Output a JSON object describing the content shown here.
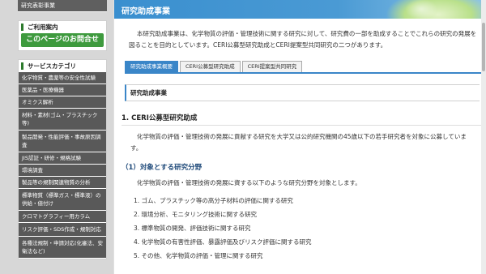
{
  "sidebar": {
    "top_item": "研究表彰事業",
    "contact_heading": "ご利用案内",
    "contact_button": "このページのお問合せ",
    "category_heading": "サービスカテゴリ",
    "categories": [
      "化学物質・農薬等の安全性試験",
      "医薬品・医療機器",
      "オミクス解析",
      "材料・素材(ゴム・プラスチック等)",
      "製品開発・性能評価・事故原因調査",
      "JIS認証・研修・規格試験",
      "環境調査",
      "製品等の規制関連物質の分析",
      "標準物質（標準ガス・標準液）の供給・値付け",
      "クロマトグラフィー用カラム",
      "リスク評価・SDS作成・規制対応",
      "各種法規制・申請対応(化審法、安衛法など)"
    ]
  },
  "header": {
    "title": "研究助成事業"
  },
  "intro": "本研究助成事業は、化学物質の評価・管理技術に関する研究に対して、研究費の一部を助成することでこれらの研究の発展を図ることを目的としています。CERI公募型研究助成とCERI提案型共同研究の二つがあります。",
  "tabs": [
    "研究助成事業概要",
    "CERI公募型研究助成",
    "CERI提案型共同研究"
  ],
  "section_title": "研究助成事業",
  "h2": "1. CERI公募型研究助成",
  "h2_text": "化学物質の評価・管理技術の発展に貢献する研究を大学又は公的研究機関の45歳以下の若手研究者を対象に公募しています。",
  "h3": "（1）対象とする研究分野",
  "h3_text": "化学物質の評価・管理技術の発展に資する以下のような研究分野を対象とします。",
  "list": [
    "1. ゴム、プラスチック等の高分子材料の評価に関する研究",
    "2. 環境分析、モニタリング技術に関する研究",
    "3. 標準物質の開発、評価技術に関する研究",
    "4. 化学物質の有害性評価、暴露評価及びリスク評価に関する研究",
    "5. その他、化学物質の評価・管理に関する研究"
  ]
}
